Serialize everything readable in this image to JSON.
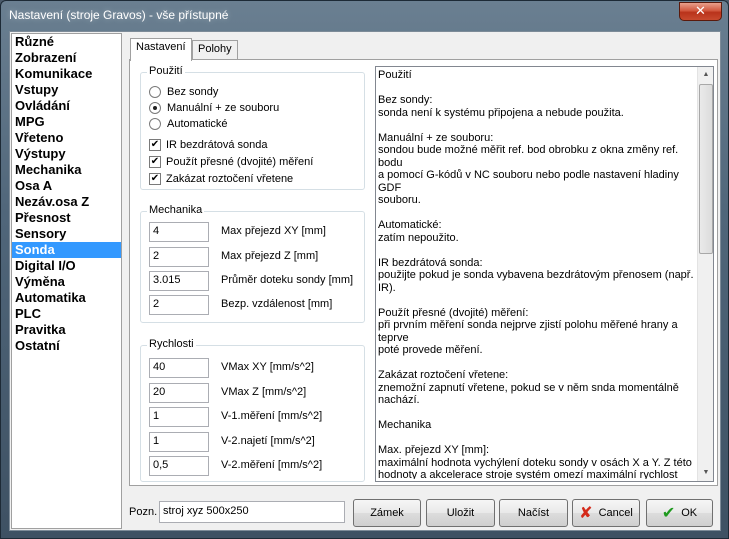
{
  "window": {
    "title": "Nastavení (stroje Gravos) - vše přístupné",
    "close_glyph": "✕"
  },
  "sidebar": {
    "items": [
      {
        "label": "Různé"
      },
      {
        "label": "Zobrazení"
      },
      {
        "label": "Komunikace"
      },
      {
        "label": "Vstupy"
      },
      {
        "label": "Ovládání"
      },
      {
        "label": "MPG"
      },
      {
        "label": "Vřeteno"
      },
      {
        "label": "Výstupy"
      },
      {
        "label": "Mechanika"
      },
      {
        "label": "Osa A"
      },
      {
        "label": "Nezáv.osa Z"
      },
      {
        "label": "Přesnost"
      },
      {
        "label": "Sensory"
      },
      {
        "label": "Sonda"
      },
      {
        "label": "Digital I/O"
      },
      {
        "label": "Výměna"
      },
      {
        "label": "Automatika"
      },
      {
        "label": "PLC"
      },
      {
        "label": "Pravitka"
      },
      {
        "label": "Ostatní"
      }
    ],
    "selected": "Sonda"
  },
  "tabs": [
    {
      "label": "Nastavení"
    },
    {
      "label": "Polohy"
    }
  ],
  "pouziti": {
    "title": "Použití",
    "radios": [
      {
        "label": "Bez sondy",
        "checked": false
      },
      {
        "label": "Manuální + ze souboru",
        "checked": true
      },
      {
        "label": "Automatické",
        "checked": false
      }
    ],
    "checks": [
      {
        "label": "IR bezdrátová sonda",
        "checked": true
      },
      {
        "label": "Použít přesné (dvojité) měření",
        "checked": true
      },
      {
        "label": "Zakázat roztočení vřetene",
        "checked": true
      }
    ]
  },
  "mechanika": {
    "title": "Mechanika",
    "fields": [
      {
        "value": "4",
        "label": "Max přejezd XY [mm]"
      },
      {
        "value": "2",
        "label": "Max přejezd Z [mm]"
      },
      {
        "value": "3.015",
        "label": "Průměr doteku sondy [mm]"
      },
      {
        "value": "2",
        "label": "Bezp. vzdálenost  [mm]"
      }
    ]
  },
  "rychlosti": {
    "title": "Rychlosti",
    "fields": [
      {
        "value": "40",
        "label": "VMax XY [mm/s^2]"
      },
      {
        "value": "20",
        "label": "VMax Z [mm/s^2]"
      },
      {
        "value": "1",
        "label": "V-1.měření [mm/s^2]"
      },
      {
        "value": "1",
        "label": "V-2.najetí [mm/s^2]"
      },
      {
        "value": "0,5",
        "label": "V-2.měření [mm/s^2]"
      }
    ]
  },
  "help": {
    "text": "Použití\n\nBez sondy:\nsonda není k systému připojena a nebude použita.\n\nManuální + ze souboru:\nsondou bude možné měřit ref. bod obrobku z okna změny ref. bodu\na pomocí G-kódů v NC souboru nebo podle nastavení hladiny GDF\nsouboru.\n\nAutomatické:\nzatím nepoužito.\n\nIR bezdrátová sonda:\npoužijte pokud je sonda vybavena bezdrátovým přenosem (např.\nIR).\n\nPoužít přesné (dvojité) měření:\npři prvním měření sonda nejprve zjistí polohu měřené hrany a teprve\npoté provede měření.\n\nZakázat roztočení vřetene:\nznemožní zapnutí vřetene, pokud se v něm snda momentálně\nnachází.\n\nMechanika\n\nMax. přejezd XY [mm]:\nmaximální hodnota vychýlení doteku sondy v osách X a Y. Z této\nhodnoty a akcelerace stroje systém omezí maximální rychlost\npohybu sondy v osách X a Y (VMax XY) tak, aby nedošlo k jejímu\nzničení.",
    "arrow_up": "▲",
    "arrow_down": "▼"
  },
  "bottom": {
    "pozn_label": "Pozn.",
    "pozn_value": "stroj xyz 500x250",
    "zamek": "Zámek",
    "ulozit": "Uložit",
    "nacist": "Načíst",
    "cancel": "Cancel",
    "ok": "OK",
    "cancel_glyph": "✘",
    "ok_glyph": "✔",
    "cancel_color": "#d42a1a",
    "ok_color": "#1f9a1f"
  }
}
